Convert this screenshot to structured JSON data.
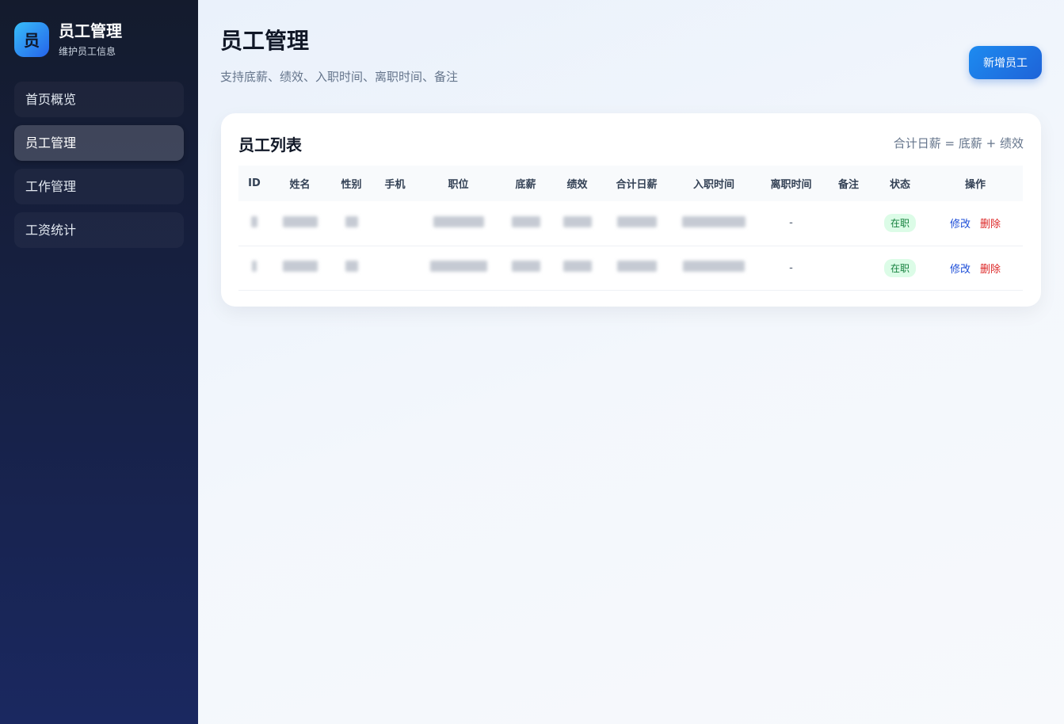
{
  "sidebar": {
    "logo_char": "员",
    "title": "员工管理",
    "subtitle": "维护员工信息",
    "items": [
      {
        "label": "首页概览"
      },
      {
        "label": "员工管理"
      },
      {
        "label": "工作管理"
      },
      {
        "label": "工资统计"
      }
    ],
    "active_index": 1
  },
  "header": {
    "title": "员工管理",
    "subtitle": "支持底薪、绩效、入职时间、离职时间、备注",
    "add_button": "新增员工"
  },
  "card": {
    "title": "员工列表",
    "note": "合计日薪 = 底薪 + 绩效",
    "columns": [
      "ID",
      "姓名",
      "性别",
      "手机",
      "职位",
      "底薪",
      "绩效",
      "合计日薪",
      "入职时间",
      "离职时间",
      "备注",
      "状态",
      "操作"
    ],
    "rows": [
      {
        "leave": "-",
        "status": "在职",
        "edit": "修改",
        "delete": "删除"
      },
      {
        "leave": "-",
        "status": "在职",
        "edit": "修改",
        "delete": "删除"
      }
    ]
  },
  "colors": {
    "accent": "#1e63d8",
    "status_green": "#15803d",
    "danger": "#dc2626"
  }
}
